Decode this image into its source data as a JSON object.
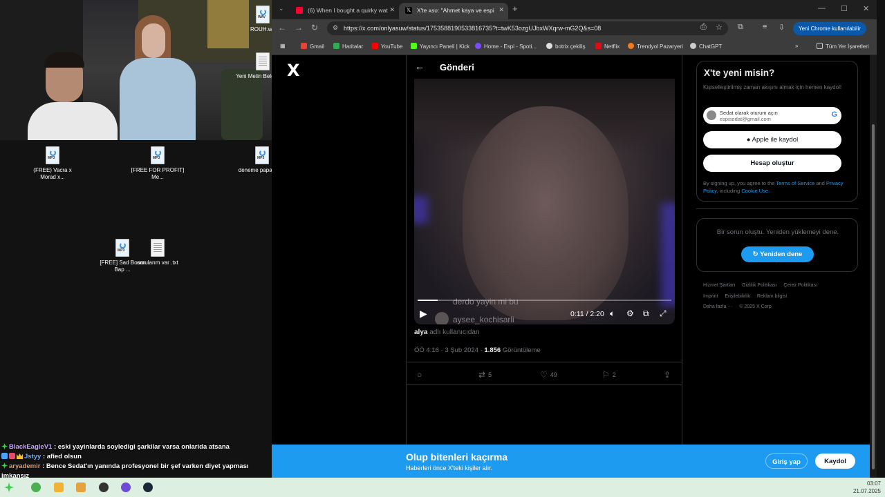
{
  "desktop": {
    "icons": [
      {
        "label": "ROUH.wa",
        "type": "WAV"
      },
      {
        "label": "Yeni Metin Belgesi (3)",
        "type": "txt"
      },
      {
        "label": "(FREE) Vacra x Morad x...",
        "type": "MP3"
      },
      {
        "label": "[FREE FOR PROFIT] Me...",
        "type": "MP3"
      },
      {
        "label": "deneme papatya.m",
        "type": "MP3"
      },
      {
        "label": "[FREE] Sad Boom Bap ...",
        "type": "MP3"
      },
      {
        "label": "sorularım var .txt",
        "type": "txt"
      }
    ]
  },
  "chat": [
    {
      "user": "BlackEagleV1",
      "message": ": eski yayinlarda soyledigi şarkilar varsa onlarida atsana"
    },
    {
      "user": "Jstyy",
      "message": ": afied olsun"
    },
    {
      "user": "aryademir",
      "message": ": Bence Sedat'ın yanında profesyonel bir şef varken diyet yapması imkansız"
    }
  ],
  "taskbar": {
    "time": "03:07",
    "date": "21.07.2025"
  },
  "browser": {
    "tabs": [
      {
        "title": "(6) When I bought a quirky wat",
        "active": false,
        "favicon_color": "#ff0033"
      },
      {
        "title": "X'te ᴀsᴜ: \"Ahmet kaya ve espi",
        "active": true,
        "favicon_color": "#000000"
      }
    ],
    "url": "https://x.com/onlyasuw/status/1753588190533816735?t=twK53ozgUJbxWXqrw-mG2Q&s=08",
    "profile_button": "Yeni Chrome kullanılabilir",
    "bookmarks": [
      {
        "label": "Gmail",
        "color": "#ea4335"
      },
      {
        "label": "Haritalar",
        "color": "#34a853"
      },
      {
        "label": "YouTube",
        "color": "#ff0000"
      },
      {
        "label": "Yayıncı Paneli | Kick",
        "color": "#53fc18"
      },
      {
        "label": "Home - Espi - Spoti...",
        "color": "#7c4dff"
      },
      {
        "label": "botrix çekiliş",
        "color": "#dddddd"
      },
      {
        "label": "Netflix",
        "color": "#e50914"
      },
      {
        "label": "Trendyol Pazaryeri",
        "color": "#f27a1a"
      },
      {
        "label": "ChatGPT",
        "color": "#cccccc"
      }
    ],
    "all_bookmarks": "Tüm Yer İşaretleri"
  },
  "x_page": {
    "logo": "X",
    "post_header": "Gönderi",
    "video": {
      "caption_1": "derdo yayin mi bu",
      "caption_2": "aysee_kochisarli",
      "time": "0:11 / 2:20",
      "progress": 0.079
    },
    "source_user": "alya",
    "source_suffix": "adlı kullanıcıdan",
    "meta_time": "ÖÖ 4:16 · 3 Şub 2024 ·",
    "views": "1.856",
    "views_label": "Görüntüleme",
    "actions": {
      "reply": "",
      "retweets": "5",
      "likes": "49",
      "bookmarks": "2"
    },
    "signup": {
      "title": "X'te yeni misin?",
      "subtitle": "Kişiselleştirilmiş zaman akışını almak için hemen kaydol!",
      "google_line1": "Sedat olarak oturum açın",
      "google_line2": "espisedat@gmail.com",
      "apple": "Apple ile kaydol",
      "create": "Hesap oluştur",
      "terms_pre": "By signing up, you agree to the",
      "terms_link": "Terms of Service",
      "terms_and": "and",
      "privacy_link": "Privacy Policy",
      "including": ", including",
      "cookie_link": "Cookie Use."
    },
    "error": {
      "message": "Bir sorun oluştu. Yeniden yüklemeyi dene.",
      "retry": "Yeniden dene"
    },
    "footer": [
      "Hizmet Şartları",
      "Gizlilik Politikası",
      "Çerez Politikası",
      "Imprint",
      "Erişilebilirlik",
      "Reklam bilgisi",
      "Daha fazla ···",
      "© 2025 X Corp."
    ],
    "banner": {
      "title": "Olup bitenleri kaçırma",
      "subtitle": "Haberleri önce X'teki kişiler alır.",
      "login": "Giriş yap",
      "register": "Kaydol"
    }
  }
}
